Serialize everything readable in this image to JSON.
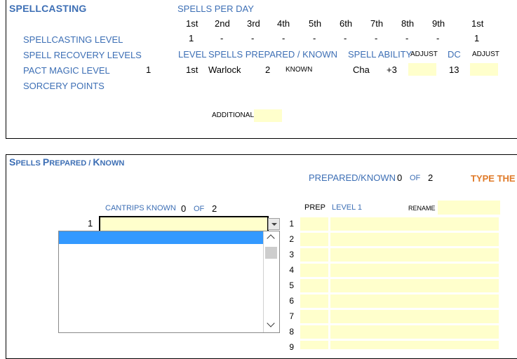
{
  "spellcasting": {
    "title": "SPELLCASTING",
    "spells_per_day_label": "SPELLS PER DAY",
    "levels": [
      "1st",
      "2nd",
      "3rd",
      "4th",
      "5th",
      "6th",
      "7th",
      "8th",
      "9th"
    ],
    "pact_level_header": "1st",
    "row_labels": {
      "spellcasting_level": "SPELLCASTING LEVEL",
      "spell_recovery_levels": "SPELL RECOVERY LEVELS",
      "pact_magic_level": "PACT MAGIC LEVEL",
      "sorcery_points": "SORCERY POINTS"
    },
    "slots": [
      "1",
      "-",
      "-",
      "-",
      "-",
      "-",
      "-",
      "-",
      "-"
    ],
    "pact_slots": "1",
    "pact_magic_value": "1",
    "headers": {
      "level": "LEVEL",
      "spells_prepared_known": "SPELLS PREPARED / KNOWN",
      "spell_ability": "SPELL ABILITY",
      "adjust": "ADJUST",
      "dc": "DC",
      "adjust2": "ADJUST"
    },
    "class_row": {
      "level": "1st",
      "class": "Warlock",
      "count": "2",
      "type": "KNOWN",
      "ability": "Cha",
      "modifier": "+3",
      "dc": "13"
    },
    "additional_label": "ADDITIONAL"
  },
  "prepared": {
    "title_parts": [
      "S",
      "PELLS ",
      "P",
      "REPARED / ",
      "K",
      "NOWN"
    ],
    "prepared_known_label": "PREPARED/KNOWN",
    "prepared_count": "0",
    "of": "OF",
    "prepared_total": "2",
    "type_hint": "TYPE THE I",
    "cantrips_label": "CANTRIPS KNOWN",
    "cantrips_count": "0",
    "cantrips_total": "2",
    "cantrip_row_number": "1",
    "prep_header": "PREP",
    "level_header": "LEVEL 1",
    "rename_label": "RENAME",
    "row_numbers": [
      "1",
      "2",
      "3",
      "4",
      "5",
      "6",
      "7",
      "8",
      "9"
    ]
  }
}
